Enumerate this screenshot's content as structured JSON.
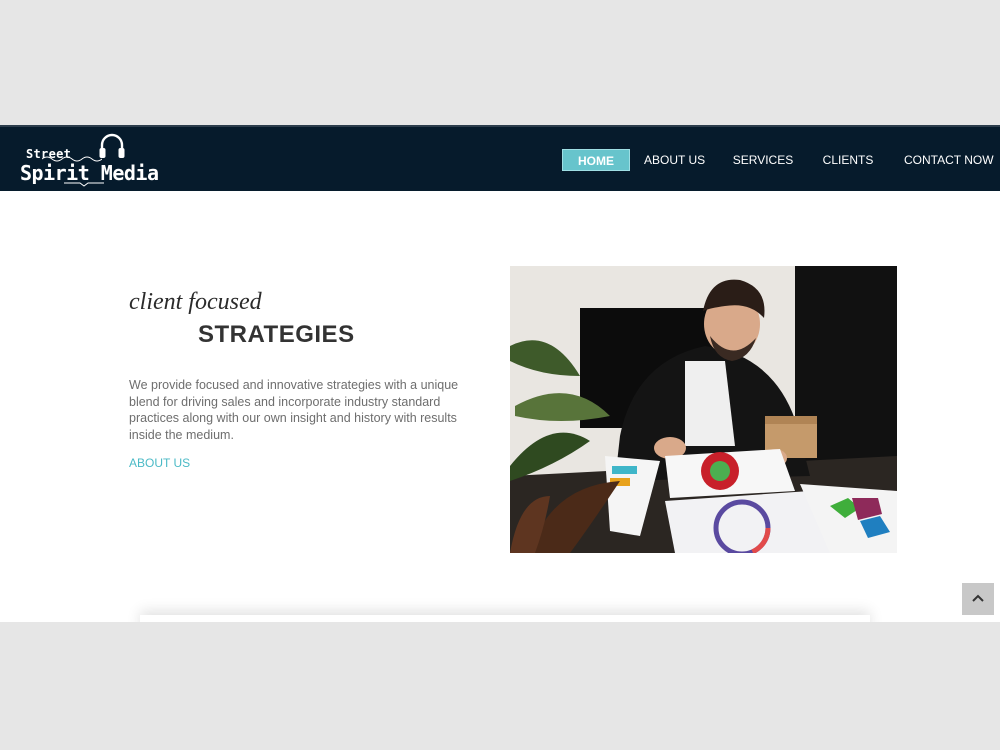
{
  "brand": {
    "line1": "Street",
    "line2": "Spirit Media"
  },
  "nav": {
    "items": [
      {
        "label": "HOME",
        "active": true
      },
      {
        "label": "ABOUT US",
        "active": false
      },
      {
        "label": "SERVICES",
        "active": false
      },
      {
        "label": "CLIENTS",
        "active": false
      },
      {
        "label": "CONTACT NOW",
        "active": false
      }
    ]
  },
  "hero": {
    "tagline": "client focused",
    "heading": "STRATEGIES",
    "description": "We provide focused and innovative strategies with a unique blend for driving sales and incorporate industry standard practices along with our own insight and history with results inside the medium.",
    "link": "ABOUT US"
  },
  "icons": {
    "logo": "headphones-icon",
    "scroll_top": "chevron-up-icon"
  },
  "colors": {
    "nav_bg": "#061b2c",
    "accent": "#67c4cc",
    "link": "#4bbac6",
    "page_bg": "#e6e6e6"
  }
}
